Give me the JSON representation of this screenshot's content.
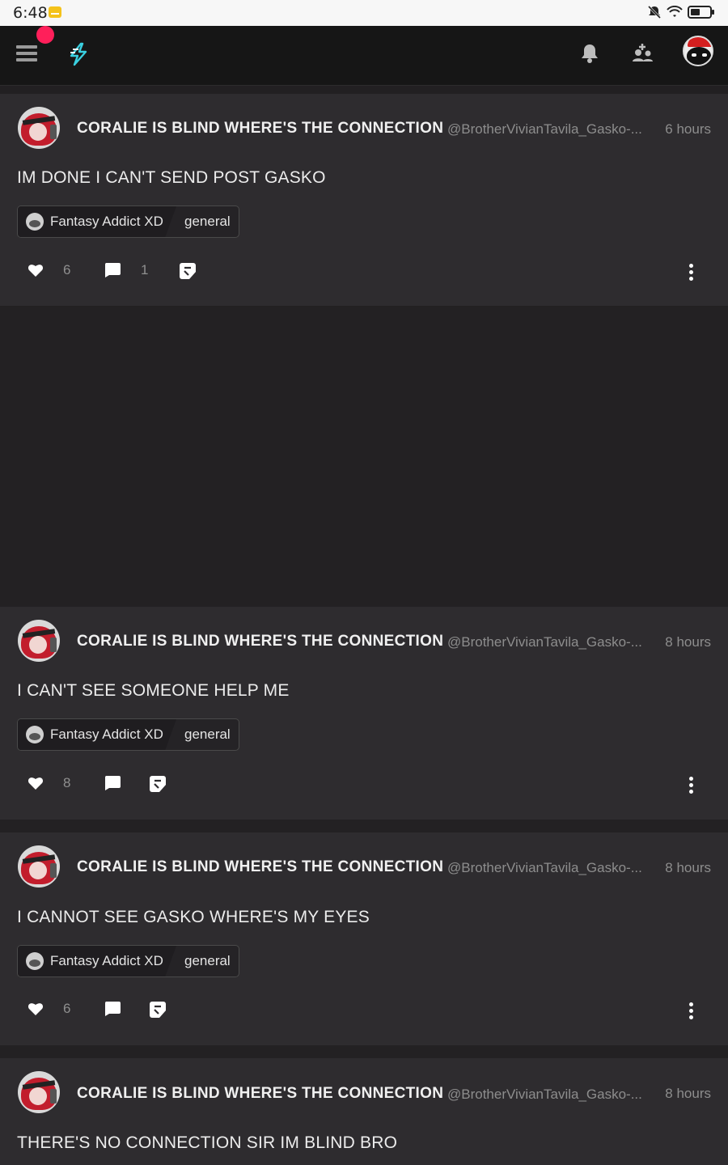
{
  "status_bar": {
    "time": "6:48"
  },
  "icons": {
    "menu": "hamburger-menu-icon",
    "logo": "lightning-logo-icon",
    "bell": "bell-icon",
    "people": "add-people-icon",
    "like": "heart-icon",
    "comment": "comment-icon",
    "share": "share-icon",
    "more": "more-vertical-icon"
  },
  "colors": {
    "accent": "#ff1f5a",
    "logo": "#3ad0e0",
    "background": "#2e2c2f"
  },
  "posts": [
    {
      "author": "CORALIE IS BLIND WHERE'S THE CONNECTION",
      "handle": "@BrotherVivianTavila_Gasko-...",
      "time": "6 hours",
      "content": "IM DONE I CAN'T SEND POST GASKO",
      "community": "Fantasy Addict XD",
      "channel": "general",
      "likes": "6",
      "comments": "1"
    },
    {
      "author": "CORALIE IS BLIND WHERE'S THE CONNECTION",
      "handle": "@BrotherVivianTavila_Gasko-...",
      "time": "8 hours",
      "content": "I CAN'T SEE SOMEONE HELP ME",
      "community": "Fantasy Addict XD",
      "channel": "general",
      "likes": "8"
    },
    {
      "author": "CORALIE IS BLIND WHERE'S THE CONNECTION",
      "handle": "@BrotherVivianTavila_Gasko-...",
      "time": "8 hours",
      "content": "I CANNOT SEE GASKO WHERE'S MY EYES",
      "community": "Fantasy Addict XD",
      "channel": "general",
      "likes": "6"
    },
    {
      "author": "CORALIE IS BLIND WHERE'S THE CONNECTION",
      "handle": "@BrotherVivianTavila_Gasko-...",
      "time": "8 hours",
      "content": "THERE'S NO CONNECTION SIR IM BLIND BRO"
    }
  ]
}
